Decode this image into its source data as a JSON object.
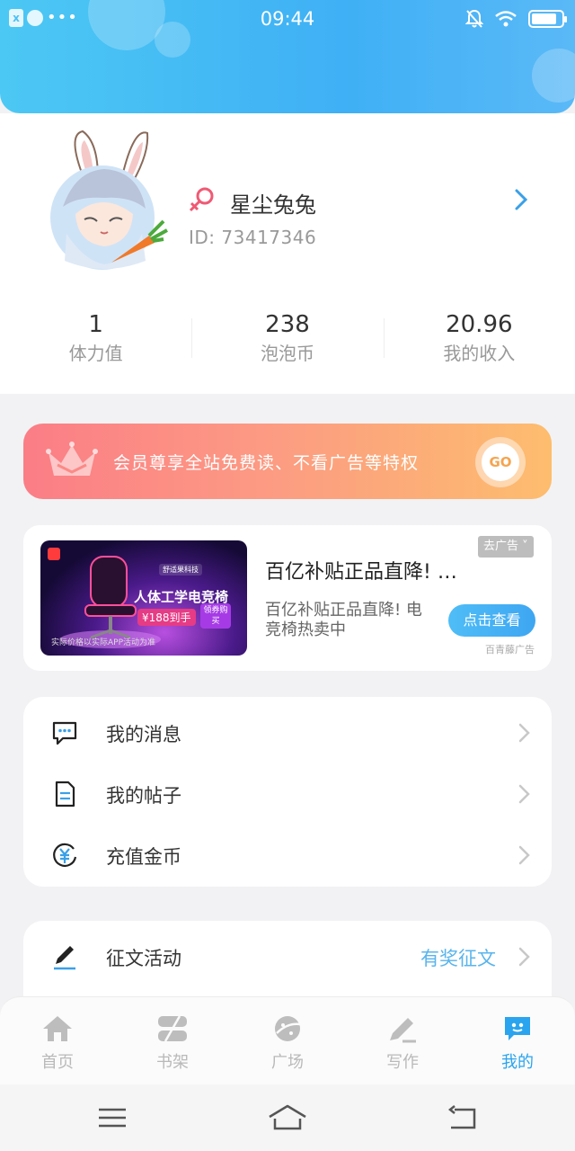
{
  "status_bar": {
    "time": "09:44",
    "battery_level": 0.85
  },
  "profile": {
    "nickname": "星尘兔兔",
    "id_text": "ID: 73417346",
    "gender": "female"
  },
  "stats": [
    {
      "value": "1",
      "label": "体力值"
    },
    {
      "value": "238",
      "label": "泡泡币"
    },
    {
      "value": "20.96",
      "label": "我的收入"
    }
  ],
  "vip_banner": {
    "text": "会员尊享全站免费读、不看广告等特权",
    "go_label": "GO"
  },
  "ad": {
    "title": "百亿补贴正品直降! …",
    "description": "百亿补贴正品直降! 电竞椅热卖中",
    "close_label": "去广告",
    "cta_label": "点击查看",
    "source": "百青藤广告",
    "image": {
      "headline": "人体工学电竞椅",
      "price": "¥188到手",
      "coupon": "领券购买",
      "brand": "舒适果科技",
      "footnote": "实际价格以实际APP活动为准"
    }
  },
  "menu_items": [
    {
      "label": "我的消息",
      "icon": "message-icon"
    },
    {
      "label": "我的帖子",
      "icon": "document-icon"
    },
    {
      "label": "充值金币",
      "icon": "yuan-coin-icon"
    }
  ],
  "activity_item": {
    "label": "征文活动",
    "extra": "有奖征文",
    "icon": "pen-icon"
  },
  "tabs": [
    {
      "label": "首页",
      "icon": "home-icon",
      "active": false
    },
    {
      "label": "书架",
      "icon": "bookshelf-icon",
      "active": false
    },
    {
      "label": "广场",
      "icon": "planet-icon",
      "active": false
    },
    {
      "label": "写作",
      "icon": "write-icon",
      "active": false
    },
    {
      "label": "我的",
      "icon": "me-bubble-icon",
      "active": true
    }
  ],
  "colors": {
    "accent": "#2aa4ee",
    "header_start": "#4cc8f4",
    "header_end": "#3fb0f5",
    "vip_start": "#fb7d86",
    "vip_end": "#fdbd6e"
  }
}
